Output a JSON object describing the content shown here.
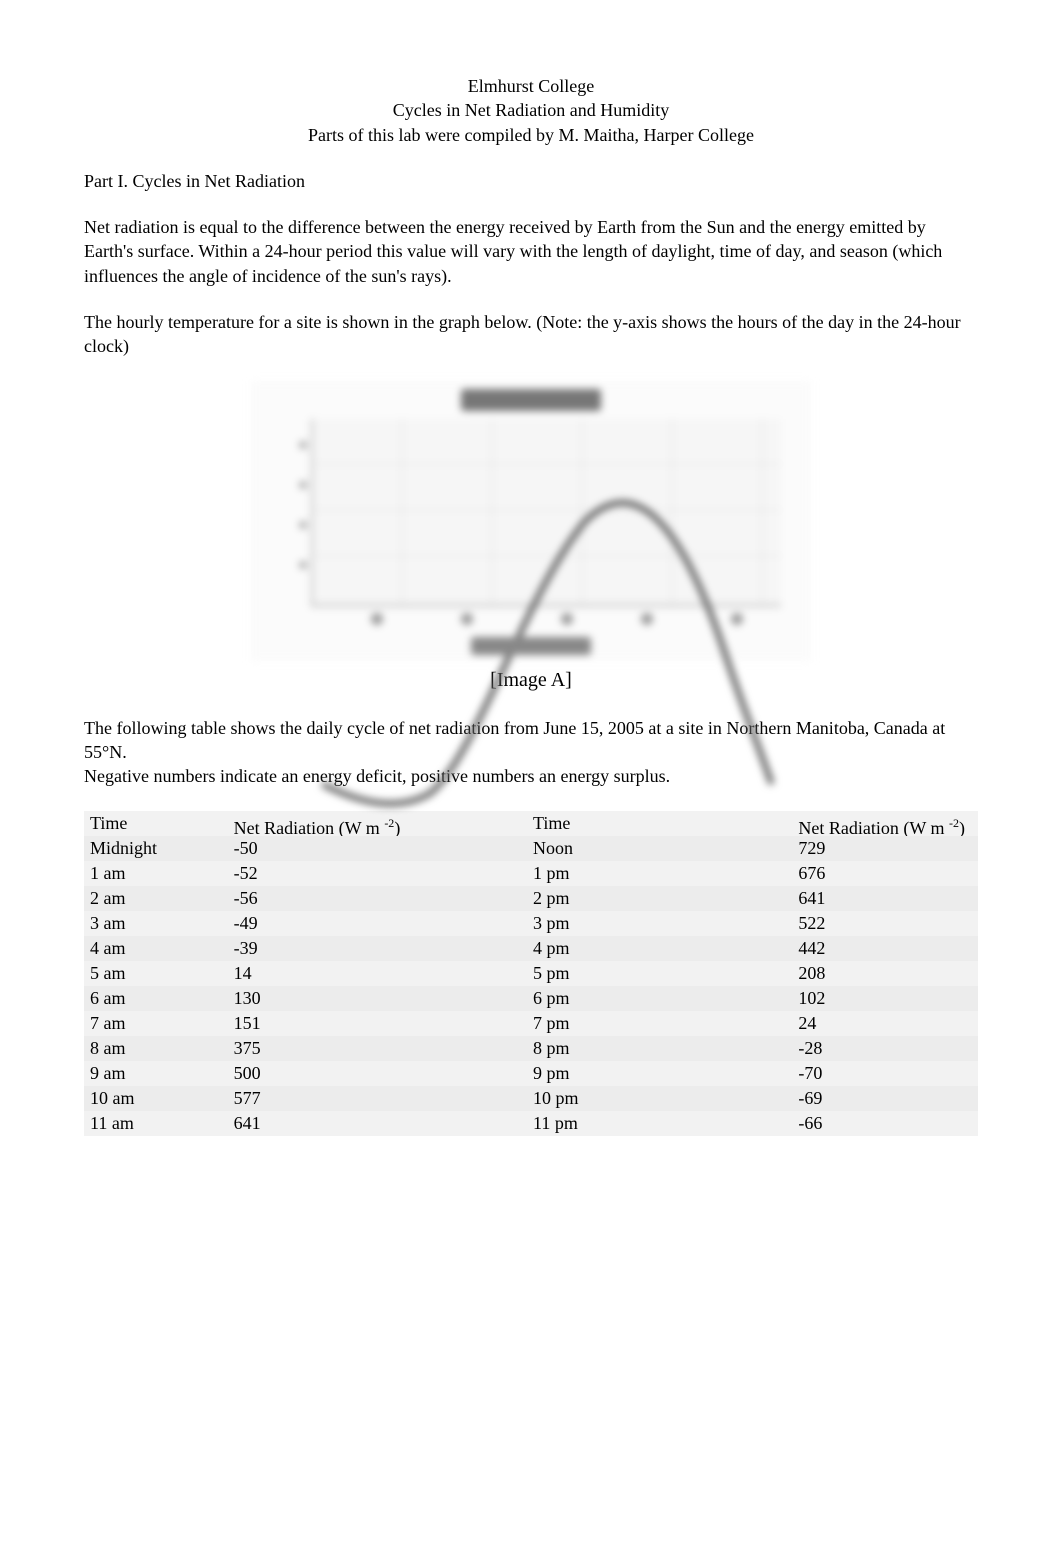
{
  "header": {
    "line1": "Elmhurst College",
    "line2": "Cycles in Net Radiation and Humidity",
    "line3": "Parts of this lab were compiled by M. Maitha, Harper College"
  },
  "section_title": "Part I. Cycles in Net Radiation",
  "para1": "Net radiation is equal to the difference between the energy received by Earth from the Sun and the energy emitted by Earth's surface. Within a 24-hour period this value will vary with the length of daylight, time of day, and season (which influences the angle of incidence of the sun's rays).",
  "para2": "The hourly temperature for a site is shown in the graph below. (Note:  the y-axis shows the hours of the day in the 24-hour clock)",
  "image_label": "[Image A]",
  "para3": "The following table shows the daily cycle of net radiation from June 15, 2005 at a site in Northern Manitoba, Canada at 55°N.",
  "para4": "Negative numbers indicate an energy deficit, positive numbers an energy surplus.",
  "table_header": {
    "time": "Time",
    "netrad_prefix": "Net Radiation (W m ",
    "netrad_exp": "-2",
    "netrad_suffix": ")"
  },
  "rows_left": [
    {
      "time": "Midnight",
      "value": "-50"
    },
    {
      "time": "1 am",
      "value": "-52"
    },
    {
      "time": "2 am",
      "value": "-56"
    },
    {
      "time": "3 am",
      "value": "-49"
    },
    {
      "time": "4 am",
      "value": "-39"
    },
    {
      "time": "5 am",
      "value": "14"
    },
    {
      "time": "6 am",
      "value": "130"
    },
    {
      "time": "7 am",
      "value": "151"
    },
    {
      "time": "8 am",
      "value": "375"
    },
    {
      "time": "9 am",
      "value": "500"
    },
    {
      "time": "10 am",
      "value": "577"
    },
    {
      "time": "11 am",
      "value": "641"
    }
  ],
  "rows_right": [
    {
      "time": "Noon",
      "value": "729"
    },
    {
      "time": "1 pm",
      "value": "676"
    },
    {
      "time": "2 pm",
      "value": "641"
    },
    {
      "time": "3 pm",
      "value": "522"
    },
    {
      "time": "4 pm",
      "value": "442"
    },
    {
      "time": "5 pm",
      "value": "208"
    },
    {
      "time": "6 pm",
      "value": "102"
    },
    {
      "time": "7 pm",
      "value": "24"
    },
    {
      "time": "8 pm",
      "value": "-28"
    },
    {
      "time": "9 pm",
      "value": "-70"
    },
    {
      "time": "10 pm",
      "value": "-69"
    },
    {
      "time": "11 pm",
      "value": "-66"
    }
  ],
  "chart_data": {
    "type": "line",
    "title": "Temperature",
    "xlabel": "Hour of Day",
    "ylabel": "",
    "note": "hours on x-axis in 24-hour clock; curve rises from early morning to afternoon peak then falls",
    "x": [
      0,
      4,
      8,
      12,
      16,
      20,
      24
    ]
  }
}
